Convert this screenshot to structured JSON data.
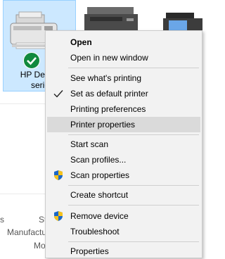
{
  "devices": [
    {
      "name_line1": "HP Deskje",
      "name_line2": "serie",
      "icon": "inkjet-printer-icon",
      "status_icon": "default-printer-check-icon",
      "selected": true
    },
    {
      "icon": "laser-printer-icon"
    },
    {
      "icon": "fax-printer-icon"
    }
  ],
  "details_fragments": {
    "left_s": "s",
    "st": "St",
    "manufactu": "Manufactu",
    "mo": "Mo"
  },
  "context_menu": {
    "items": [
      {
        "label": "Open",
        "bold": true
      },
      {
        "label": "Open in new window"
      },
      {
        "label": "See what's printing"
      },
      {
        "label": "Set as default printer",
        "checked": true
      },
      {
        "label": "Printing preferences"
      },
      {
        "label": "Printer properties",
        "highlighted": true
      },
      {
        "label": "Start scan"
      },
      {
        "label": "Scan profiles..."
      },
      {
        "label": "Scan properties",
        "icon": "uac-shield-icon"
      },
      {
        "label": "Create shortcut"
      },
      {
        "label": "Remove device",
        "icon": "uac-shield-icon"
      },
      {
        "label": "Troubleshoot"
      },
      {
        "label": "Properties"
      }
    ]
  },
  "colors": {
    "selection_bg": "#cce8ff",
    "menu_bg": "#f2f2f2",
    "menu_highlight": "#dadada",
    "check_green": "#10893e"
  }
}
